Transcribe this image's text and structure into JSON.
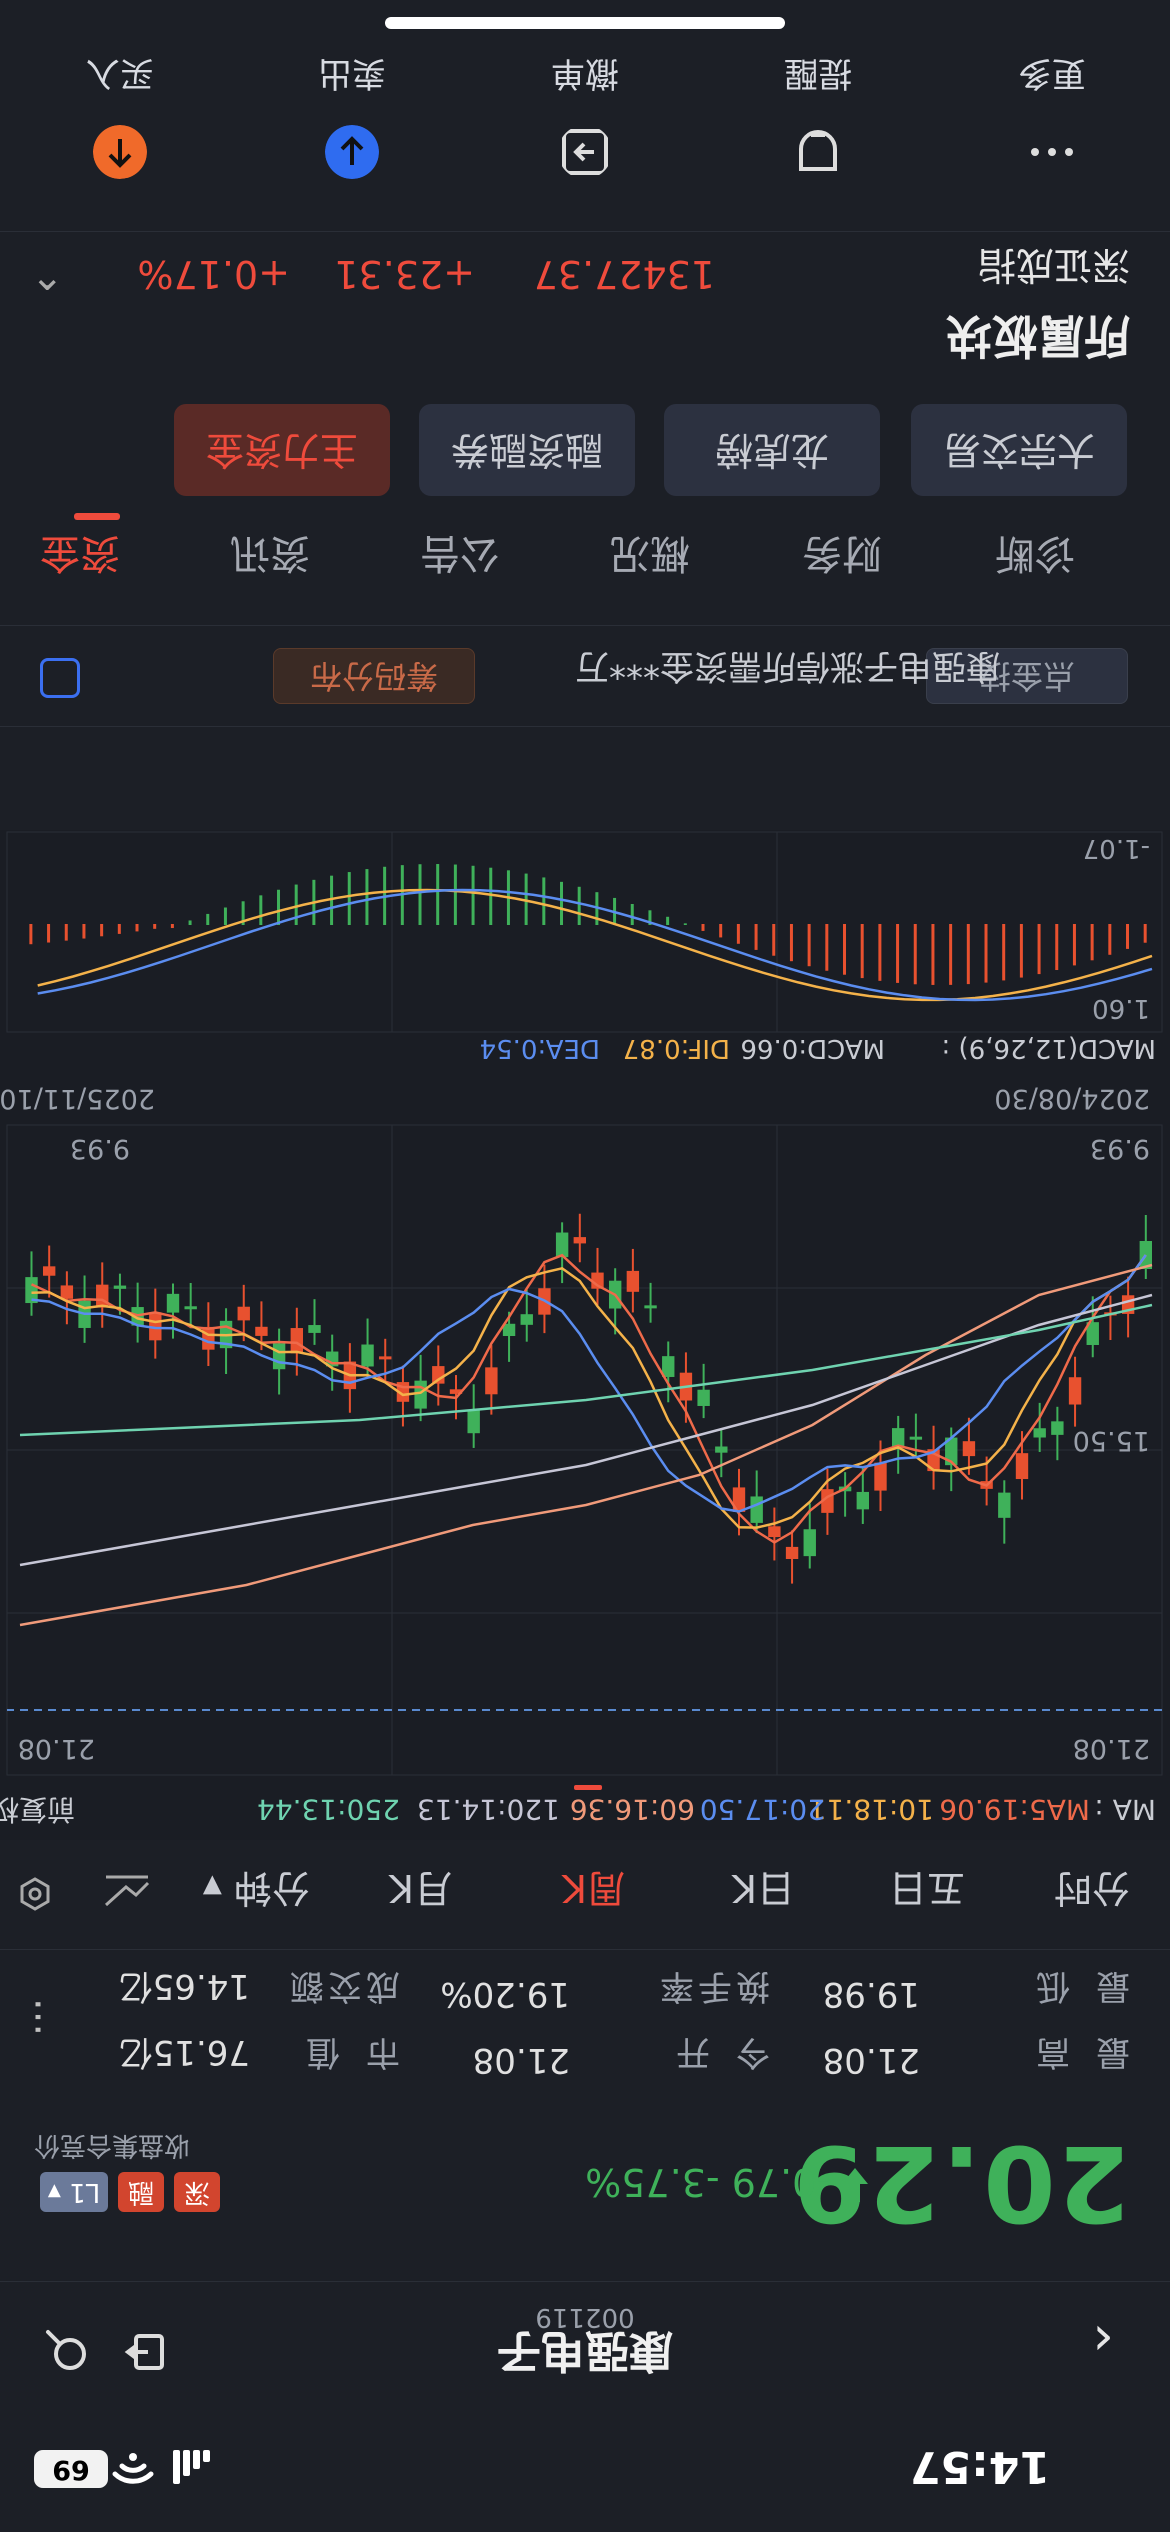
{
  "status_bar": {
    "time": "14:57",
    "battery": "69"
  },
  "header": {
    "name": "康强电子",
    "code": "002119"
  },
  "quote": {
    "price": "20.29",
    "change": "-0.79",
    "change_pct": "-3.75%",
    "auction_note": "收盘集合竞价",
    "tags": [
      "深",
      "融",
      "L1"
    ],
    "stats": [
      {
        "label": "最高",
        "value": "21.08"
      },
      {
        "label": "今开",
        "value": "21.08"
      },
      {
        "label": "市值",
        "value": "76.15亿"
      },
      {
        "label": "最低",
        "value": "19.98"
      },
      {
        "label": "换手率",
        "value": "19.20%"
      },
      {
        "label": "成交额",
        "value": "14.65亿"
      }
    ]
  },
  "period_tabs": [
    "分时",
    "五日",
    "日K",
    "周K",
    "月K",
    "分钟"
  ],
  "period_active": "周K",
  "ma_legend": {
    "label": "MA :",
    "ma5": "MA5:19.06",
    "ma10": "10:18.11",
    "ma20": "20:17.50",
    "ma60": "60:16.36",
    "ma120": "120:14.13",
    "ma250": "250:13.44",
    "adj": "前复权"
  },
  "kline": {
    "high_label": "21.08",
    "high_label_left": "21.08",
    "mid_label": "15.50",
    "low_label": "9.93",
    "low_label_right": "9.93",
    "date_start": "2024/08/30",
    "date_end": "2025/11/10"
  },
  "macd": {
    "title": "MACD(12,26,9) :",
    "macd": "MACD:0.66",
    "dif": "DIF:0.87",
    "dea": "DEA:0.54",
    "top_label": "1.60",
    "bottom_label": "-1.07"
  },
  "funds_bar": {
    "text": "康强电子涨停所需资金***万",
    "btn1": "筹码分布",
    "btn2": "点金技"
  },
  "lower_tabs": [
    "资金",
    "资讯",
    "公告",
    "概况",
    "财务",
    "诊断"
  ],
  "lower_active": "资金",
  "sub_buttons": [
    "主力资金",
    "融资融券",
    "龙虎榜",
    "大宗交易"
  ],
  "sector": {
    "title": "所属板块",
    "name": "深证成指",
    "value": "13427.37",
    "change": "+23.31",
    "change_pct": "+0.17%"
  },
  "actions": [
    {
      "label": "买入",
      "icon": "buy-icon",
      "color": "#f06a2a"
    },
    {
      "label": "卖出",
      "icon": "sell-icon",
      "color": "#2f6cf0"
    },
    {
      "label": "撤单",
      "icon": "cancel-order-icon",
      "color": ""
    },
    {
      "label": "提醒",
      "icon": "alert-icon",
      "color": ""
    },
    {
      "label": "更多",
      "icon": "more-icon",
      "color": ""
    }
  ]
}
